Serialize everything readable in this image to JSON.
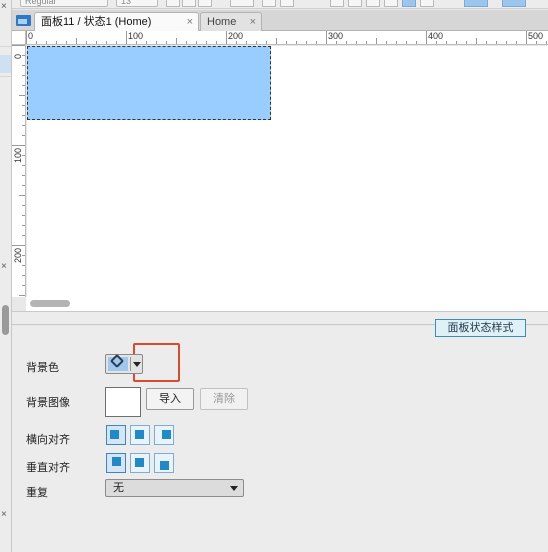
{
  "toolbar": {
    "font_style": "Regular",
    "font_size": "13"
  },
  "tabs": [
    {
      "label": "面板11 / 状态1 (Home)",
      "close": "×",
      "active": true
    },
    {
      "label": "Home",
      "close": "×",
      "active": false
    }
  ],
  "ruler": {
    "h_labels": [
      "0",
      "100",
      "200",
      "300",
      "400",
      "500"
    ],
    "v_labels": [
      "0",
      "100",
      "200"
    ]
  },
  "gutter": {
    "close_marks": [
      "×",
      "×",
      "×"
    ]
  },
  "panel": {
    "tab_label": "面板状态样式",
    "bg_color_label": "背景色",
    "bg_color_value": "#9ec8ee",
    "bg_image_label": "背景图像",
    "import_label": "导入",
    "clear_label": "清除",
    "h_align_label": "横向对齐",
    "v_align_label": "垂直对齐",
    "repeat_label": "重复",
    "repeat_value": "无"
  },
  "colors": {
    "shape_fill": "#99ccff",
    "highlight_border": "#d94a2f",
    "accent": "#1f8ac7"
  }
}
